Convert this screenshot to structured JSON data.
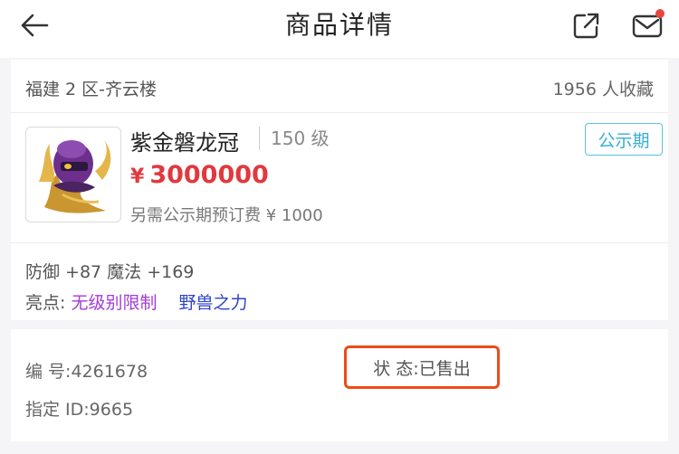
{
  "header": {
    "title": "商品详情",
    "back_icon": "arrow-left-icon",
    "share_icon": "share-icon",
    "message_icon": "mail-icon",
    "notification_color": "#e8453c"
  },
  "listing": {
    "server": "福建 2 区-齐云楼",
    "favorites": "1956 人收藏",
    "item_name": "紫金磐龙冠",
    "level": "150 级",
    "badge": "公示期",
    "price_symbol": "¥",
    "price": "3000000",
    "deposit": "另需公示期预订费 ¥ 1000",
    "stats": "防御 +87 魔法 +169",
    "highlight_label": "亮点:",
    "highlights": [
      "无级别限制",
      "野兽之力"
    ],
    "colors": {
      "price": "#e0393e",
      "badge": "#36aed6",
      "highlight_1": "#a43bd8",
      "highlight_2": "#2f43c6"
    }
  },
  "info": {
    "number": "编 号:4261678",
    "status": "状 态:已售出",
    "designated_id": "指定 ID:9665",
    "status_box_color": "#ee4a19"
  }
}
